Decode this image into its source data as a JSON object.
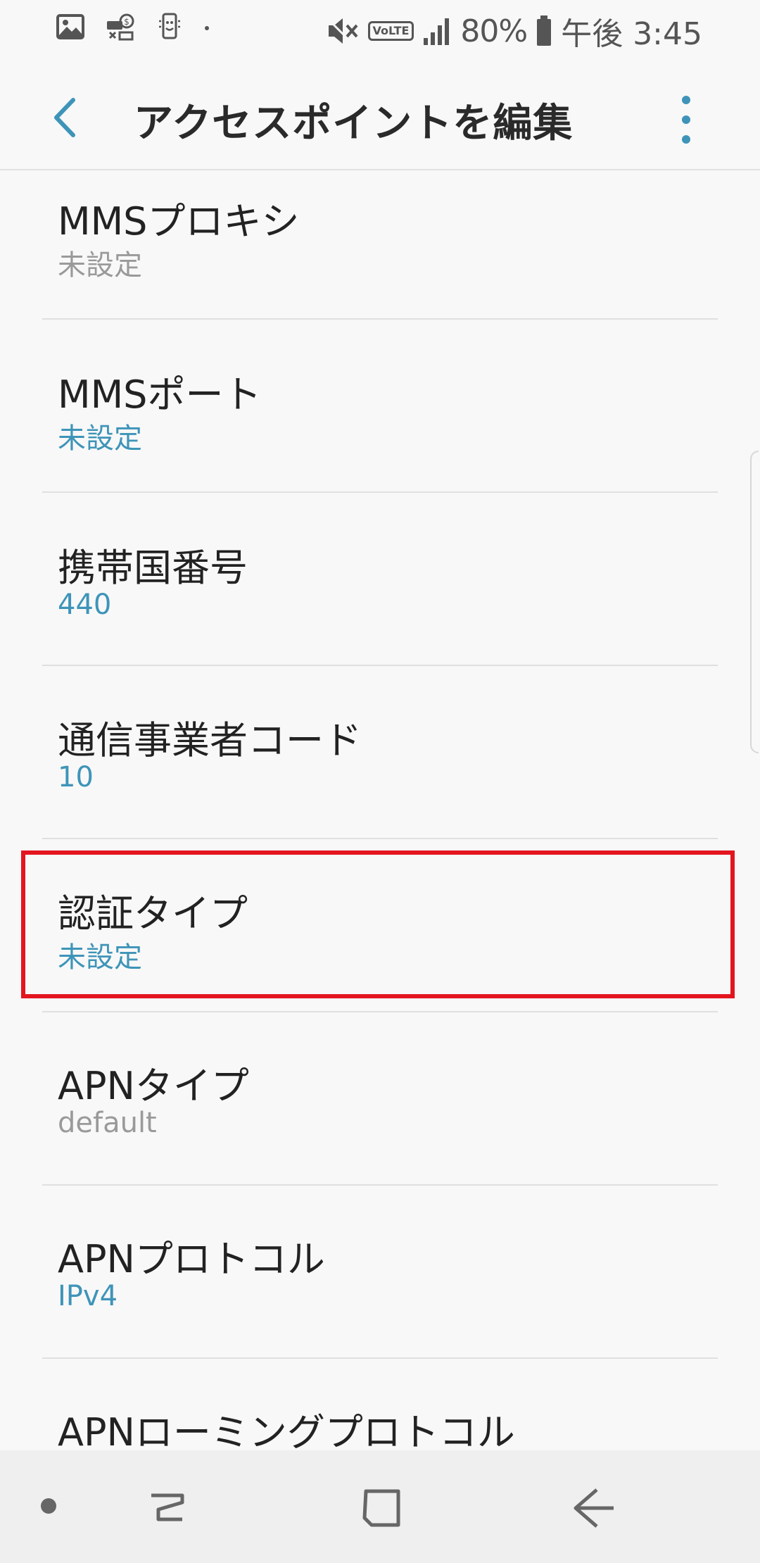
{
  "status_bar": {
    "battery_percent": "80%",
    "time": "午後 3:45",
    "volte_label": "VoLTE"
  },
  "app_bar": {
    "title": "アクセスポイントを編集"
  },
  "items": [
    {
      "label": "MMSプロキシ",
      "value": "未設定",
      "value_style": "gray"
    },
    {
      "label": "MMSポート",
      "value": "未設定",
      "value_style": "blue"
    },
    {
      "label": "携帯国番号",
      "value": "440",
      "value_style": "blue"
    },
    {
      "label": "通信事業者コード",
      "value": "10",
      "value_style": "blue"
    },
    {
      "label": "認証タイプ",
      "value": "未設定",
      "value_style": "blue",
      "highlighted": true
    },
    {
      "label": "APNタイプ",
      "value": "default",
      "value_style": "gray"
    },
    {
      "label": "APNプロトコル",
      "value": "IPv4",
      "value_style": "blue"
    },
    {
      "label": "APNローミングプロトコル",
      "value": "",
      "value_style": "blue"
    }
  ],
  "colors": {
    "accent": "#3e94b8",
    "secondary_text": "#9a9a9a",
    "highlight": "#e3151f"
  }
}
